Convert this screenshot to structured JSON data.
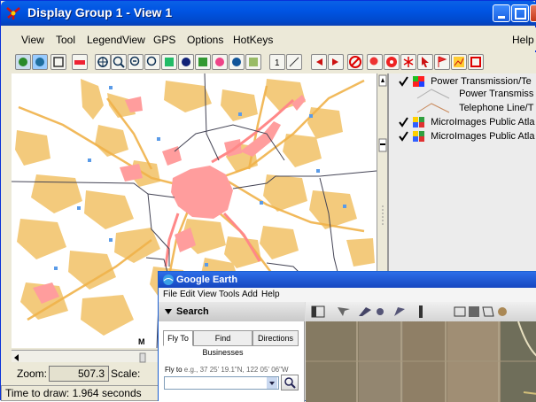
{
  "window": {
    "title": "Display Group 1 - View 1"
  },
  "menu": {
    "items": [
      "View",
      "Tool",
      "LegendView",
      "GPS",
      "Options",
      "HotKeys"
    ],
    "help": "Help"
  },
  "legend": {
    "layers": [
      {
        "label": "Power Transmission/Te",
        "checked": true
      },
      {
        "label": "Power Transmiss",
        "checked": false
      },
      {
        "label": "Telephone Line/T",
        "checked": false
      },
      {
        "label": "MicroImages Public Atla",
        "checked": true
      },
      {
        "label": "MicroImages Public Atla",
        "checked": true
      }
    ]
  },
  "status": {
    "zoom_label": "Zoom:",
    "zoom_value": "507.3",
    "scale_label": "Scale:",
    "draw_time": "Time to draw: 1.964 seconds"
  },
  "google_earth": {
    "title": "Google Earth",
    "menu": [
      "File",
      "Edit",
      "View",
      "Tools",
      "Add",
      "Help"
    ],
    "search_header": "Search",
    "tabs": [
      "Fly To",
      "Find Businesses",
      "Directions"
    ],
    "fly_to_label": "Fly to",
    "fly_to_example": "e.g., 37 25' 19.1\"N, 122 05' 06\"W"
  },
  "colors": {
    "title_blue": "#0054e3",
    "map_roads": "#f2c56d",
    "map_urban": "#ff9d9d",
    "map_blue_pt": "#5a9be8"
  }
}
